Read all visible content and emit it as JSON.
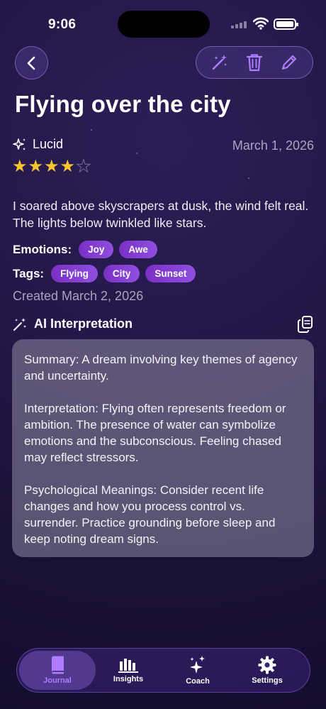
{
  "status_bar": {
    "time": "9:06"
  },
  "header": {
    "title": "Flying over the city"
  },
  "dream": {
    "type": "Lucid",
    "date": "March 1, 2026",
    "rating": 4,
    "rating_max": 5,
    "description": "I soared above skyscrapers at dusk, the wind felt real. The lights below twinkled like stars.",
    "emotions_label": "Emotions:",
    "emotions": [
      "Joy",
      "Awe"
    ],
    "tags_label": "Tags:",
    "tags": [
      "Flying",
      "City",
      "Sunset"
    ],
    "created": "Created March 2, 2026"
  },
  "ai": {
    "title": "AI Interpretation",
    "summary": "Summary: A dream involving key themes of agency and uncertainty.",
    "interpretation": "Interpretation: Flying often represents freedom or ambition. The presence of water can symbolize emotions and the subconscious. Feeling chased may reflect stressors.",
    "psychological": "Psychological Meanings: Consider recent life changes and how you process control vs. surrender. Practice grounding before sleep and keep noting dream signs."
  },
  "tabs": [
    {
      "label": "Journal",
      "icon": "book-icon",
      "active": true
    },
    {
      "label": "Insights",
      "icon": "chart-icon",
      "active": false
    },
    {
      "label": "Coach",
      "icon": "sparkles-icon",
      "active": false
    },
    {
      "label": "Settings",
      "icon": "gear-icon",
      "active": false
    }
  ],
  "colors": {
    "accent": "#b07cff",
    "star": "#f7c62b",
    "chip": "#8a45d8"
  }
}
